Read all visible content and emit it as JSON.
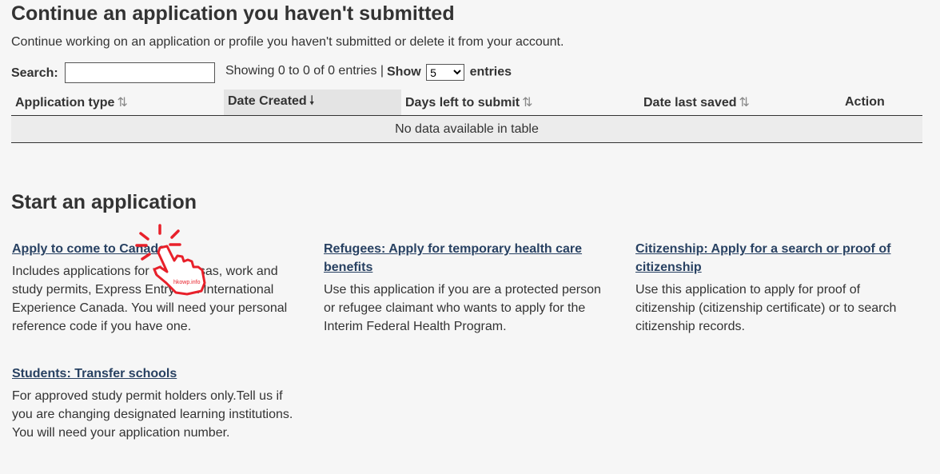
{
  "continue_section": {
    "title": "Continue an application you haven't submitted",
    "intro": "Continue working on an application or profile you haven't submitted or delete it from your account."
  },
  "table_controls": {
    "search_label": "Search:",
    "search_value": "",
    "info_text": "Showing 0 to 0 of 0 entries |",
    "show_label": "Show",
    "entries_label": "entries",
    "page_size_selected": "5"
  },
  "table": {
    "headers": [
      {
        "label": "Application type",
        "sort": "both"
      },
      {
        "label": "Date Created",
        "sort": "desc"
      },
      {
        "label": "Days left to submit",
        "sort": "both"
      },
      {
        "label": "Date last saved",
        "sort": "both"
      },
      {
        "label": "Action",
        "sort": "none"
      }
    ],
    "empty_message": "No data available in table"
  },
  "start_section": {
    "title": "Start an application",
    "cards": [
      {
        "link": "Apply to come to Canada",
        "description": "Includes applications for visitor visas, work and study permits, Express Entry and International Experience Canada. You will need your personal reference code if you have one."
      },
      {
        "link": "Refugees: Apply for temporary health care benefits",
        "description": "Use this application if you are a protected person or refugee claimant who wants to apply for the Interim Federal Health Program."
      },
      {
        "link": "Citizenship: Apply for a search or proof of citizenship",
        "description": "Use this application to apply for proof of citizenship (citizenship certificate) or to search citizenship records."
      },
      {
        "link": "Students: Transfer schools",
        "description": "For approved study permit holders only.Tell us if you are changing designated learning institutions. You will need your application number."
      }
    ]
  },
  "watermark": "hkowp.info",
  "colors": {
    "link": "#284162",
    "cursor_overlay": "#e8202a",
    "sorted_header_bg": "#e4e4e4"
  },
  "icons": {
    "sort_both": "sort-both-icon",
    "sort_desc": "sort-desc-icon",
    "cursor": "hand-pointer-icon"
  }
}
